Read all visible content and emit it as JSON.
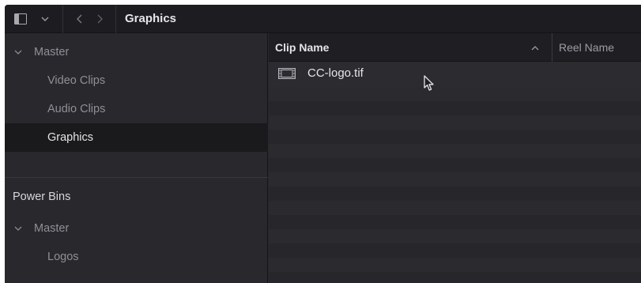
{
  "header": {
    "title": "Graphics",
    "icons": [
      "sidebar-toggle-icon",
      "chevron-down-icon",
      "back-icon",
      "forward-icon"
    ]
  },
  "sidebar": {
    "master_label": "Master",
    "items": [
      {
        "label": "Video Clips",
        "selected": false
      },
      {
        "label": "Audio Clips",
        "selected": false
      },
      {
        "label": "Graphics",
        "selected": true
      }
    ],
    "power_bins": {
      "title": "Power Bins",
      "master_label": "Master",
      "items": [
        {
          "label": "Logos"
        }
      ]
    }
  },
  "list": {
    "columns": {
      "clip_name": "Clip Name",
      "reel_name": "Reel Name",
      "sort": "ascending"
    },
    "clips": [
      {
        "name": "CC-logo.tif",
        "icon": "film-clip-icon"
      }
    ]
  },
  "colors": {
    "panel_bg": "#28282d",
    "header_bg": "#1d1d21",
    "selected_bg": "#1a1a1d",
    "text_primary": "#e6e6ea",
    "text_muted": "#8f8f96"
  }
}
